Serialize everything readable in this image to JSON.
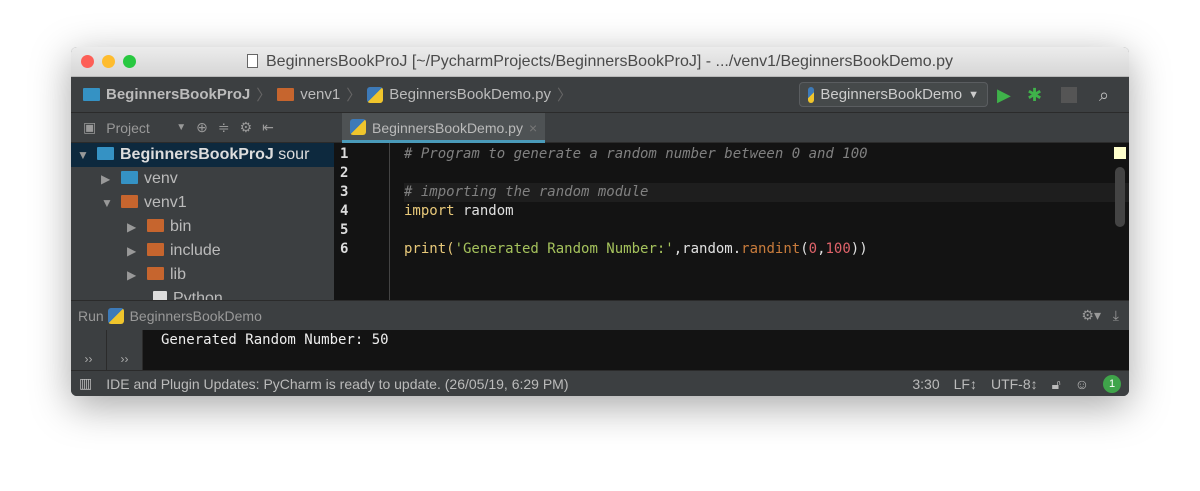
{
  "window": {
    "title": "BeginnersBookProJ [~/PycharmProjects/BeginnersBookProJ] - .../venv1/BeginnersBookDemo.py"
  },
  "breadcrumb": [
    "BeginnersBookProJ",
    "venv1",
    "BeginnersBookDemo.py"
  ],
  "toolbar": {
    "run_config": "BeginnersBookDemo"
  },
  "project_panel": {
    "label": "Project"
  },
  "tree": [
    {
      "label": "BeginnersBookProJ",
      "suffix": "sour"
    },
    {
      "label": "venv"
    },
    {
      "label": "venv1"
    },
    {
      "label": "bin"
    },
    {
      "label": "include"
    },
    {
      "label": "lib"
    },
    {
      "label": "Python"
    }
  ],
  "editor": {
    "tab": "BeginnersBookDemo.py",
    "line_numbers": [
      "1",
      "2",
      "3",
      "4",
      "5",
      "6"
    ],
    "code": {
      "l1": "# Program to generate a random number between 0 and 100",
      "l3": "# importing the random module",
      "l4_kw": "import",
      "l4_rest": " random",
      "l6_a": "print(",
      "l6_str": "'Generated Random Number:'",
      "l6_b": ",random.",
      "l6_fn": "randint",
      "l6_c": "(",
      "l6_n1": "0",
      "l6_d": ",",
      "l6_n2": "100",
      "l6_e": "))"
    }
  },
  "run": {
    "label": "Run",
    "config": "BeginnersBookDemo",
    "output": "Generated Random Number: 50"
  },
  "status": {
    "message": "IDE and Plugin Updates: PyCharm is ready to update. (26/05/19, 6:29 PM)",
    "position": "3:30",
    "line_sep": "LF↕",
    "encoding": "UTF-8↕",
    "notifications": "1"
  },
  "colors": {
    "accent": "#4a9bba",
    "run": "#3fb24a",
    "selection": "#0d293e"
  }
}
